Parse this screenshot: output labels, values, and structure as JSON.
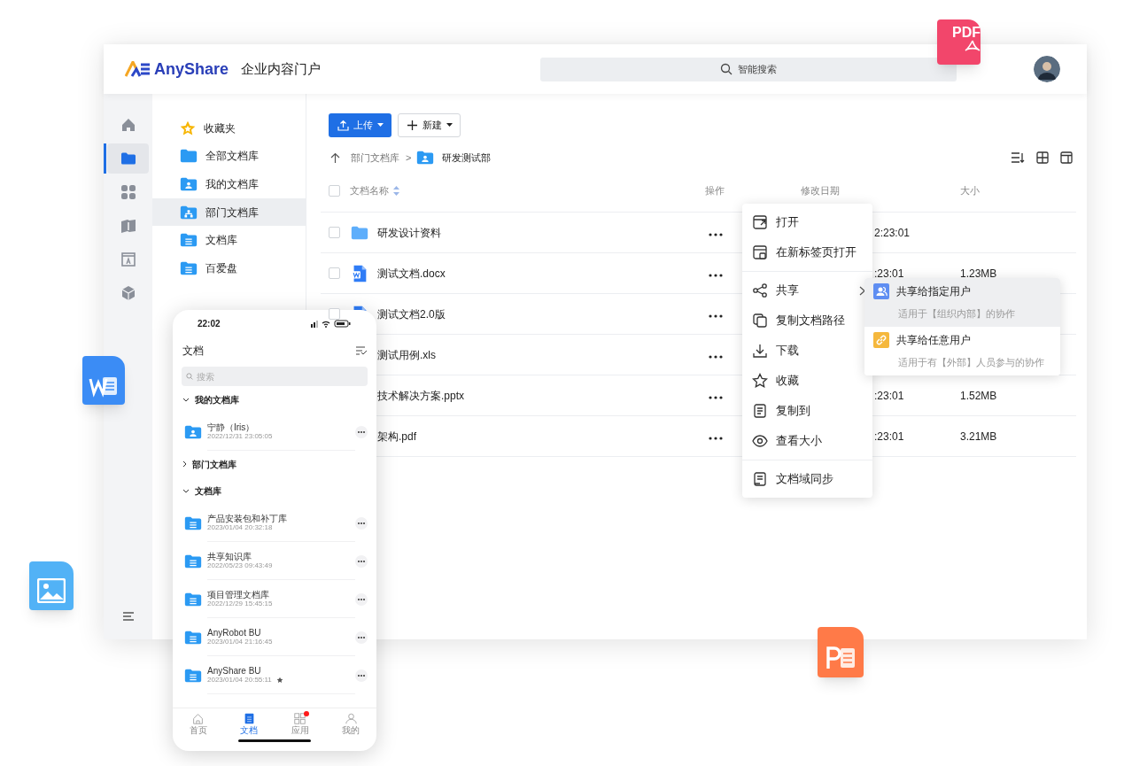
{
  "header": {
    "logo": "AnyShare",
    "portal": "企业内容门户",
    "search": {
      "placeholder": "智能搜索"
    }
  },
  "rail": [
    {
      "kind": "home",
      "selected": false
    },
    {
      "kind": "folder",
      "selected": true
    },
    {
      "kind": "apps",
      "selected": false
    },
    {
      "kind": "book",
      "selected": false
    },
    {
      "kind": "text",
      "selected": false
    },
    {
      "kind": "cube",
      "selected": false
    }
  ],
  "nav": [
    {
      "kind": "star",
      "label": "收藏夹",
      "selected": false
    },
    {
      "kind": "folder",
      "label": "全部文档库",
      "selected": false
    },
    {
      "kind": "user",
      "label": "我的文档库",
      "selected": false
    },
    {
      "kind": "org",
      "label": "部门文档库",
      "selected": true
    },
    {
      "kind": "lib",
      "label": "文档库",
      "selected": false
    },
    {
      "kind": "lib",
      "label": "百爱盘",
      "selected": false
    }
  ],
  "toolbar": {
    "upload": "上传",
    "new": "新建"
  },
  "breadcrumb": {
    "parent": "部门文档库",
    "separator": ">",
    "current": "研发测试部"
  },
  "table": {
    "columns": [
      "文档名称",
      "操作",
      "修改日期",
      "大小"
    ],
    "all_checked": false,
    "rows": [
      {
        "kind": "folder",
        "name": "研发设计资料",
        "date": "2:23:01",
        "checked": false
      },
      {
        "kind": "word",
        "name": "测试文档.docx",
        "date": ":23:01",
        "size": "1.23MB",
        "checked": false
      },
      {
        "kind": "word",
        "name": "测试文档2.0版",
        "checked": false
      },
      {
        "kind": "hidden",
        "name": "测试用例.xls"
      },
      {
        "kind": "hidden",
        "name": "技术解决方案.pptx",
        "date": ":23:01",
        "size": "1.52MB"
      },
      {
        "kind": "hidden",
        "name": "架构.pdf",
        "date": ":23:01",
        "size": "3.21MB"
      }
    ]
  },
  "context_menu": [
    [
      {
        "kind": "open",
        "label": "打开"
      },
      {
        "kind": "newtab",
        "label": "在新标签页打开"
      }
    ],
    [
      {
        "kind": "share",
        "label": "共享",
        "submenu": true
      },
      {
        "kind": "copypath",
        "label": "复制文档路径",
        "submenu": false
      },
      {
        "kind": "download",
        "label": "下载",
        "submenu": false
      },
      {
        "kind": "star",
        "label": "收藏",
        "submenu": false
      },
      {
        "kind": "copyto",
        "label": "复制到",
        "submenu": false
      },
      {
        "kind": "eye",
        "label": "查看大小",
        "submenu": false
      }
    ],
    [
      {
        "kind": "sync",
        "label": "文档域同步"
      }
    ]
  ],
  "submenu": [
    {
      "kind": "users",
      "title": "共享给指定用户",
      "description": "适用于【组织内部】的协作",
      "selected": true
    },
    {
      "kind": "link",
      "title": "共享给任意用户",
      "description": "适用于有【外部】人员参与的协作",
      "selected": false
    }
  ],
  "phone": {
    "time": "22:02",
    "title": "文档",
    "search": {
      "placeholder": "搜索"
    },
    "sections": [
      {
        "title": "我的文档库",
        "expanded": true,
        "items": [
          {
            "kind": "user",
            "name": "宁静（Iris）",
            "date": "2022/12/31 23:05:05",
            "starred": false
          }
        ]
      },
      {
        "title": "部门文档库",
        "expanded": false
      },
      {
        "title": "文档库",
        "expanded": true,
        "items": [
          {
            "kind": "lib",
            "name": "产品安装包和补丁库",
            "date": "2023/01/04 20:32:18",
            "starred": false
          },
          {
            "kind": "lib",
            "name": "共享知识库",
            "date": "2022/05/23 09:43:49",
            "starred": false
          },
          {
            "kind": "lib",
            "name": "项目管理文档库",
            "date": "2022/12/29 15:45:15",
            "starred": false
          },
          {
            "kind": "lib",
            "name": "AnyRobot BU",
            "date": "2023/01/04 21:16:45",
            "starred": false
          },
          {
            "kind": "lib",
            "name": "AnyShare BU",
            "date": "2023/01/04 20:55:11",
            "starred": true
          }
        ]
      }
    ],
    "tabs": [
      {
        "kind": "home",
        "label": "首页",
        "selected": false,
        "badge": false
      },
      {
        "kind": "docs",
        "label": "文档",
        "selected": true,
        "badge": false
      },
      {
        "kind": "apps",
        "label": "应用",
        "selected": false,
        "badge": true
      },
      {
        "kind": "me",
        "label": "我的",
        "selected": false,
        "badge": false
      }
    ]
  },
  "floating": [
    {
      "kind": "pdf",
      "label": "PDF"
    },
    {
      "kind": "word"
    },
    {
      "kind": "image"
    },
    {
      "kind": "ppt"
    }
  ]
}
